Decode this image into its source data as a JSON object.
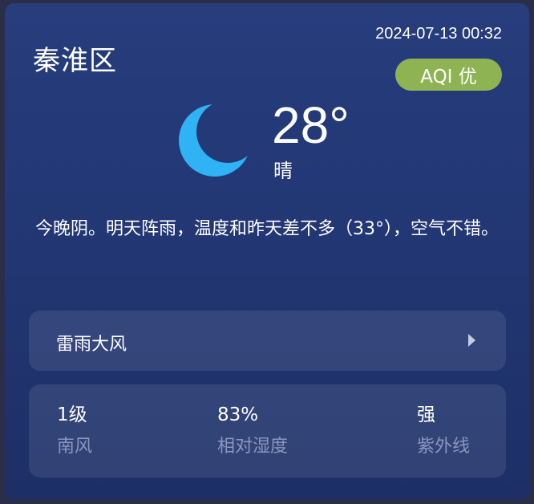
{
  "header": {
    "location": "秦淮区",
    "timestamp": "2024-07-13 00:32",
    "aqi_label": "AQI 优",
    "aqi_color": "#8db352"
  },
  "current": {
    "icon": "moon-icon",
    "icon_color": "#2fb3f5",
    "temperature": "28°",
    "condition": "晴"
  },
  "summary": "今晚阴。明天阵雨，温度和昨天差不多（33°），空气不错。",
  "alert": {
    "label": "雷雨大风",
    "chevron_icon": "chevron-right-icon"
  },
  "stats": [
    {
      "value": "1级",
      "label": "南风"
    },
    {
      "value": "83%",
      "label": "相对湿度"
    },
    {
      "value": "强",
      "label": "紫外线"
    }
  ]
}
